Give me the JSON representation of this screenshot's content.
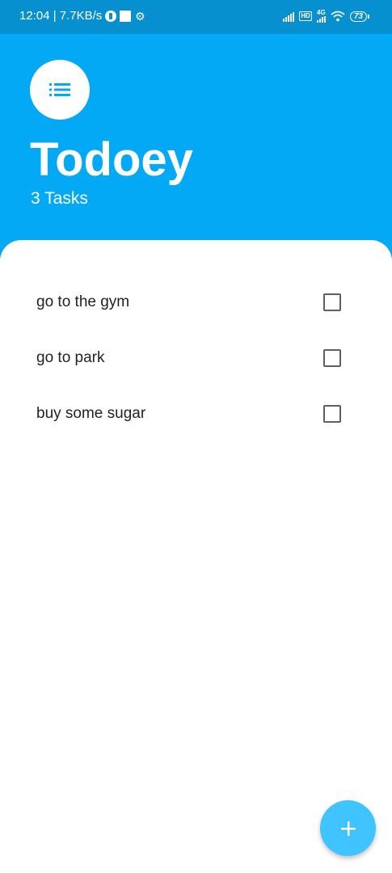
{
  "status_bar": {
    "time_speed": "12:04 | 7.7KB/s",
    "network_tag": "HD",
    "network_type": "4G",
    "battery_level": "73",
    "icons": [
      "vpn-icon",
      "square-icon",
      "gear-icon",
      "signal-icon",
      "hd-icon",
      "4g-signal-icon",
      "wifi-icon",
      "battery-icon"
    ]
  },
  "header": {
    "logo_icon": "list-icon",
    "title": "Todoey",
    "task_count": "3 Tasks"
  },
  "tasks": [
    {
      "label": "go to the gym",
      "checked": false
    },
    {
      "label": "go to park",
      "checked": false
    },
    {
      "label": "buy some sugar",
      "checked": false
    }
  ],
  "fab": {
    "icon": "add-icon",
    "symbol": "+"
  },
  "colors": {
    "primary": "#03a9f4",
    "status_bar": "#0790cf",
    "fab": "#40c4ff",
    "icon_blue": "#03a9f4"
  }
}
